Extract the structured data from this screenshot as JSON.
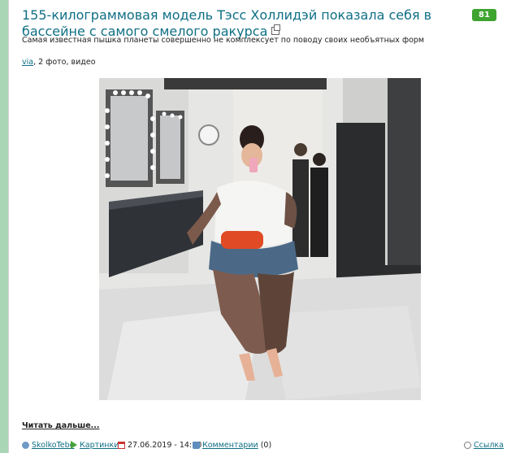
{
  "post": {
    "title": "155-килограммовая модель Тэсс Холлидэй показала себя в бассейне с самого смелого ракурса",
    "score": "81",
    "subtitle": "Самая известная пышка планеты совершенно не комплексует по поводу своих необъятных форм",
    "source_link": "via",
    "source_rest": ", 2 фото, видео",
    "read_more": "Читать дальше...",
    "icons": {
      "external": "external-link-icon",
      "user": "user-icon",
      "category": "arrow-right-icon",
      "date": "calendar-icon",
      "comments": "comment-icon",
      "link": "link-icon"
    }
  },
  "footer": {
    "author": "SkolkoTebe",
    "category": "Картинки",
    "date": "27.06.2019 - 14:10",
    "comments_label": "Комментарии",
    "comments_count": "(0)",
    "link_label": "Ссылка"
  },
  "colors": {
    "title": "#0f6f85",
    "score_badge": "#3ea42f",
    "left_stripe": "#a9d7b6"
  }
}
